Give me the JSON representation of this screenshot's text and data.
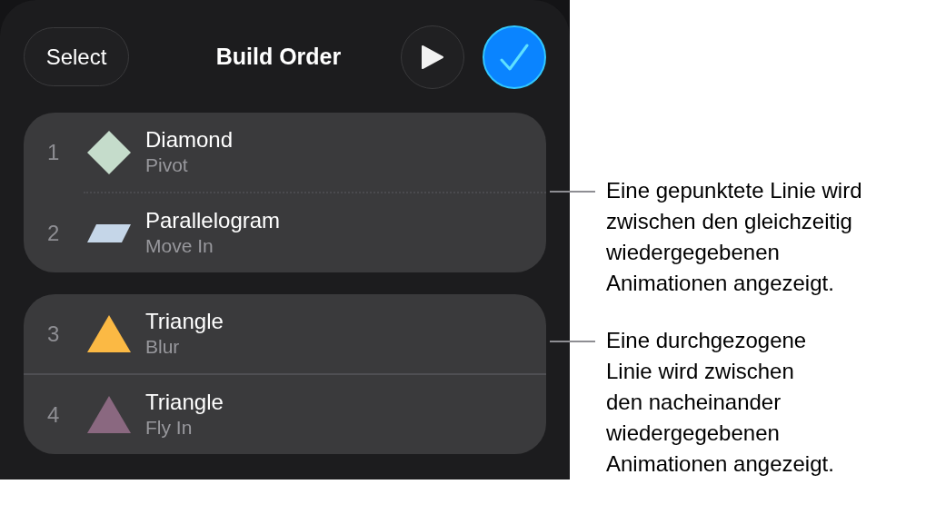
{
  "header": {
    "select_button": "Select",
    "title": "Build Order"
  },
  "groups": [
    {
      "divider": {
        "kind": "dotted"
      },
      "items": [
        {
          "number": "1",
          "name": "Diamond",
          "effect": "Pivot",
          "shape": {
            "kind": "diamond",
            "color": "#c5dccb"
          }
        },
        {
          "number": "2",
          "name": "Parallelogram",
          "effect": "Move In",
          "shape": {
            "kind": "parallelogram",
            "color": "#c5d6e8"
          }
        }
      ]
    },
    {
      "divider": {
        "kind": "solid"
      },
      "items": [
        {
          "number": "3",
          "name": "Triangle",
          "effect": "Blur",
          "shape": {
            "kind": "triangle",
            "color": "#fbb944"
          }
        },
        {
          "number": "4",
          "name": "Triangle",
          "effect": "Fly In",
          "shape": {
            "kind": "triangle",
            "color": "#8a6880"
          }
        }
      ]
    }
  ],
  "callouts": [
    {
      "lines": [
        "Eine gepunktete Linie wird",
        "zwischen den gleichzeitig",
        "wiedergegebenen",
        "Animationen angezeigt."
      ]
    },
    {
      "lines": [
        "Eine durchgezogene",
        "Linie wird zwischen",
        "den nacheinander",
        "wiedergegebenen",
        "Animationen angezeigt."
      ]
    }
  ]
}
